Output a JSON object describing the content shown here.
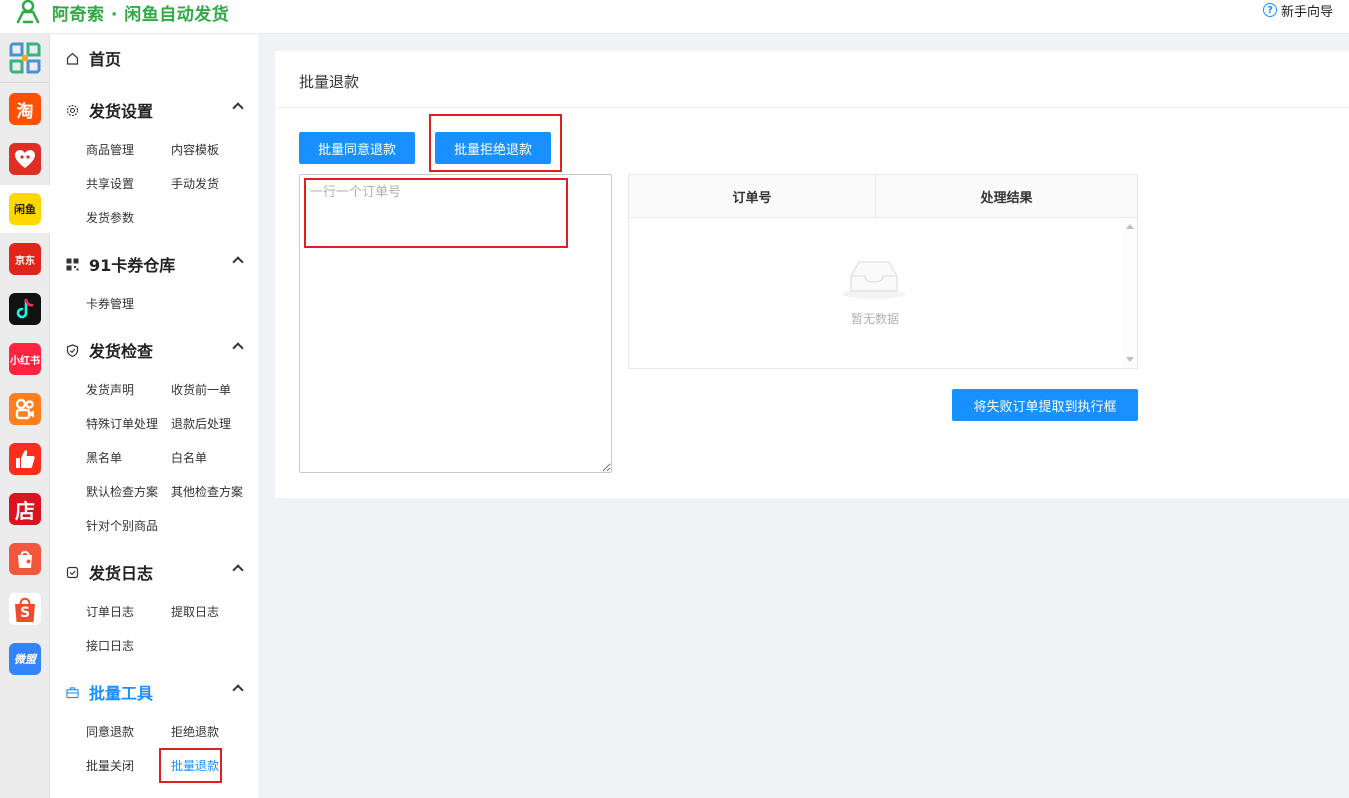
{
  "header": {
    "title": "阿奇索 · 闲鱼自动发货",
    "help_label": "新手向导",
    "help_icon": "question-circle-icon"
  },
  "platforms": [
    {
      "name": "platform-qr",
      "label": "",
      "color": "#3a8ee6"
    },
    {
      "name": "platform-taobao",
      "label": "淘",
      "color": "#ff5000"
    },
    {
      "name": "platform-pinduoduo",
      "label": "",
      "color": "#e02e24"
    },
    {
      "name": "platform-xianyu",
      "label": "闲鱼",
      "color": "#ffd800"
    },
    {
      "name": "platform-jd",
      "label": "京东",
      "color": "#e1251b"
    },
    {
      "name": "platform-douyin",
      "label": "",
      "color": "#111111"
    },
    {
      "name": "platform-xiaohongshu",
      "label": "小红书",
      "color": "#ff2442"
    },
    {
      "name": "platform-kuaishou",
      "label": "",
      "color": "#ff7e1d"
    },
    {
      "name": "platform-dianzan",
      "label": "",
      "color": "#ff2d1b"
    },
    {
      "name": "platform-dian",
      "label": "店",
      "color": "#d9141e"
    },
    {
      "name": "platform-youzan",
      "label": "",
      "color": "#f2573b"
    },
    {
      "name": "platform-shopee",
      "label": "S",
      "color": "#ee4d2d"
    },
    {
      "name": "platform-weimeng",
      "label": "微盟",
      "color": "#3584ff"
    }
  ],
  "sidebar": {
    "home": "首页",
    "groups": [
      {
        "label": "发货设置",
        "items": [
          "商品管理",
          "内容模板",
          "共享设置",
          "手动发货",
          "发货参数"
        ]
      },
      {
        "label": "91卡券仓库",
        "items": [
          "卡券管理"
        ]
      },
      {
        "label": "发货检查",
        "items": [
          "发货声明",
          "收货前一单",
          "特殊订单处理",
          "退款后处理",
          "黑名单",
          "白名单",
          "默认检查方案",
          "其他检查方案",
          "针对个别商品"
        ]
      },
      {
        "label": "发货日志",
        "items": [
          "订单日志",
          "提取日志",
          "接口日志"
        ]
      },
      {
        "label": "批量工具",
        "items": [
          "同意退款",
          "拒绝退款",
          "批量关闭",
          "批量退款"
        ]
      }
    ]
  },
  "main": {
    "title": "批量退款",
    "btn_agree": "批量同意退款",
    "btn_reject": "批量拒绝退款",
    "order_placeholder": "一行一个订单号",
    "table": {
      "col_order": "订单号",
      "col_result": "处理结果",
      "empty": "暂无数据"
    },
    "btn_extract": "将失败订单提取到执行框"
  },
  "colors": {
    "brand_green": "#2eaa44",
    "primary_blue": "#1890ff",
    "highlight_red": "#e02020"
  }
}
